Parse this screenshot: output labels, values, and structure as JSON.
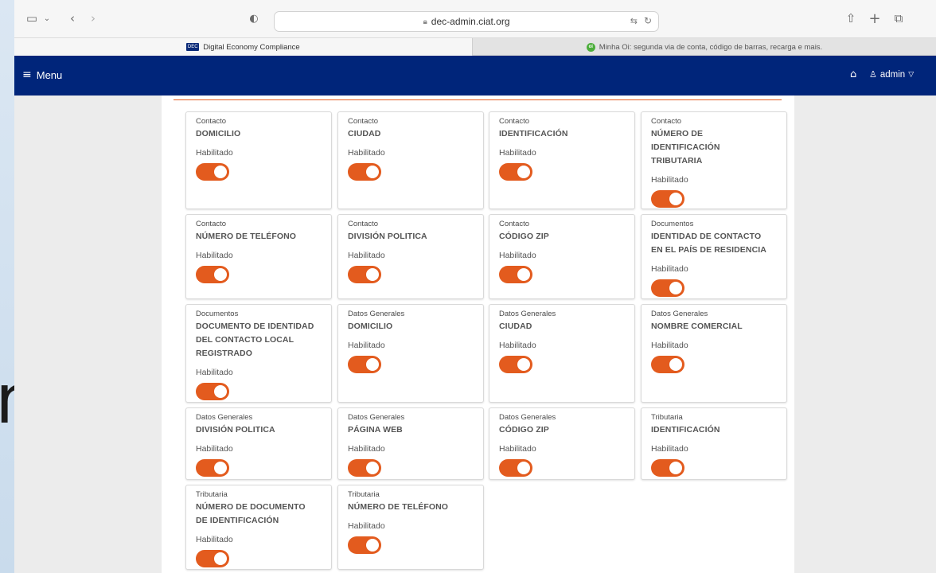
{
  "browser": {
    "url": "dec-admin.ciat.org",
    "tabs": [
      {
        "label": "Digital Economy Compliance",
        "favicon": "DEC",
        "active": true
      },
      {
        "label": "Minha Oi: segunda via de conta, código de barras, recarga e mais.",
        "favicon": "oi",
        "active": false
      }
    ]
  },
  "desktop": {
    "glyph": "n"
  },
  "navbar": {
    "menu_label": "Menu",
    "user_label": "admin"
  },
  "colors": {
    "navbar": "#00257a",
    "accent": "#e35b1e",
    "panel": "#ffffff",
    "page": "#ececec"
  },
  "cards": [
    {
      "category": "Contacto",
      "title": "DOMICILIO",
      "status": "Habilitado",
      "enabled": true
    },
    {
      "category": "Contacto",
      "title": "CIUDAD",
      "status": "Habilitado",
      "enabled": true
    },
    {
      "category": "Contacto",
      "title": "IDENTIFICACIÓN",
      "status": "Habilitado",
      "enabled": true
    },
    {
      "category": "Contacto",
      "title": "NÚMERO DE IDENTIFICACIÓN TRIBUTARIA",
      "status": "Habilitado",
      "enabled": true
    },
    {
      "category": "Contacto",
      "title": "NÚMERO DE TELÉFONO",
      "status": "Habilitado",
      "enabled": true
    },
    {
      "category": "Contacto",
      "title": "DIVISIÓN POLITICA",
      "status": "Habilitado",
      "enabled": true
    },
    {
      "category": "Contacto",
      "title": "CÓDIGO ZIP",
      "status": "Habilitado",
      "enabled": true
    },
    {
      "category": "Documentos",
      "title": "IDENTIDAD DE CONTACTO EN EL PAÍS DE RESIDENCIA",
      "status": "Habilitado",
      "enabled": true
    },
    {
      "category": "Documentos",
      "title": "DOCUMENTO DE IDENTIDAD DEL CONTACTO LOCAL REGISTRADO",
      "status": "Habilitado",
      "enabled": true
    },
    {
      "category": "Datos Generales",
      "title": "DOMICILIO",
      "status": "Habilitado",
      "enabled": true
    },
    {
      "category": "Datos Generales",
      "title": "CIUDAD",
      "status": "Habilitado",
      "enabled": true
    },
    {
      "category": "Datos Generales",
      "title": "NOMBRE COMERCIAL",
      "status": "Habilitado",
      "enabled": true
    },
    {
      "category": "Datos Generales",
      "title": "DIVISIÓN POLITICA",
      "status": "Habilitado",
      "enabled": true
    },
    {
      "category": "Datos Generales",
      "title": "PÁGINA WEB",
      "status": "Habilitado",
      "enabled": true
    },
    {
      "category": "Datos Generales",
      "title": "CÓDIGO ZIP",
      "status": "Habilitado",
      "enabled": true
    },
    {
      "category": "Tributaria",
      "title": "IDENTIFICACIÓN",
      "status": "Habilitado",
      "enabled": true
    },
    {
      "category": "Tributaria",
      "title": "NÚMERO DE DOCUMENTO DE IDENTIFICACIÓN",
      "status": "Habilitado",
      "enabled": true
    },
    {
      "category": "Tributaria",
      "title": "NÚMERO DE TELÉFONO",
      "status": "Habilitado",
      "enabled": true
    }
  ]
}
